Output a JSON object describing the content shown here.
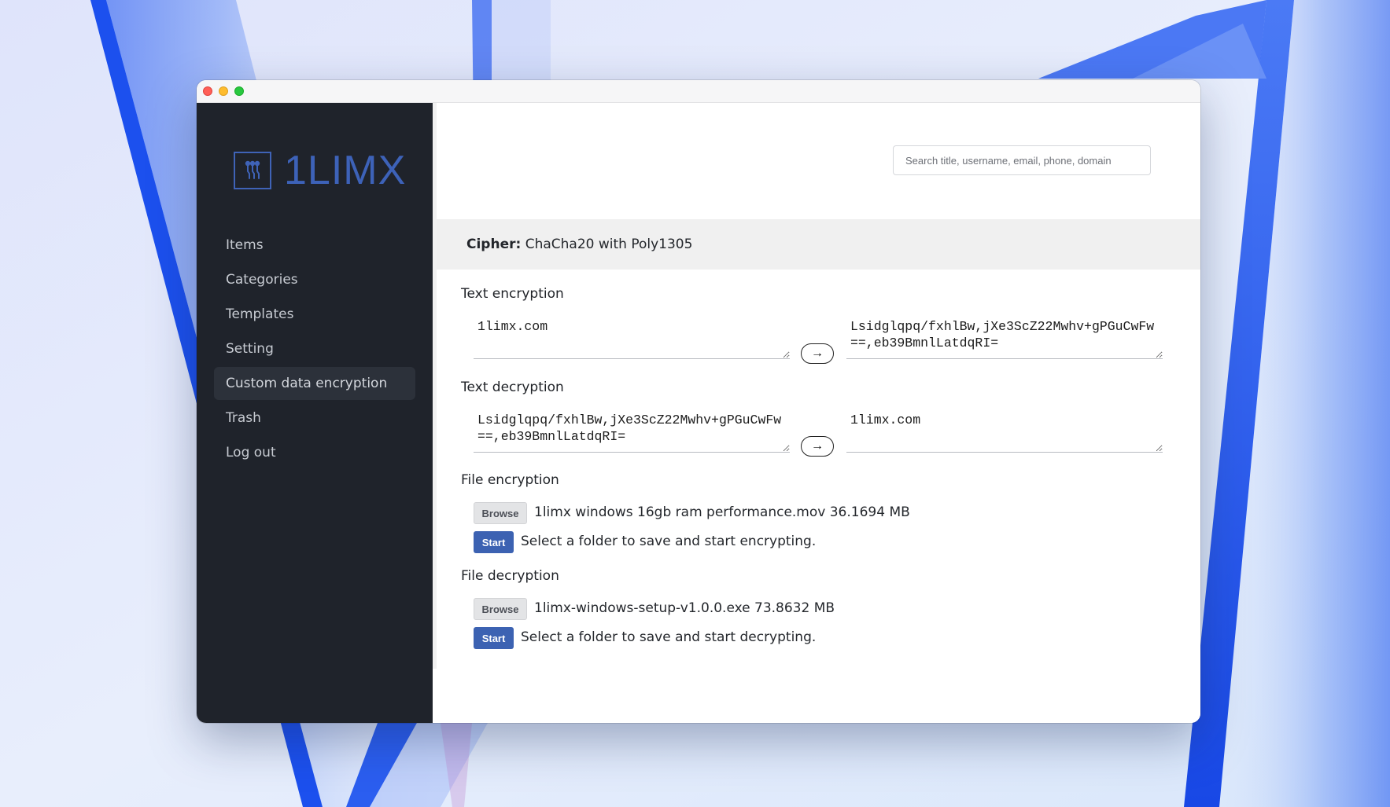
{
  "app": {
    "logo_text": "1LIMX"
  },
  "sidebar": {
    "items": [
      {
        "label": "Items"
      },
      {
        "label": "Categories"
      },
      {
        "label": "Templates"
      },
      {
        "label": "Setting"
      },
      {
        "label": "Custom data encryption",
        "active": true
      },
      {
        "label": "Trash"
      },
      {
        "label": "Log out"
      }
    ]
  },
  "header": {
    "search_placeholder": "Search title, username, email, phone, domain"
  },
  "cipher": {
    "label": "Cipher:",
    "value": "ChaCha20 with Poly1305"
  },
  "text_encryption": {
    "title": "Text encryption",
    "input": "1limx.com",
    "output": "Lsidglqpq/fxhlBw,jXe3ScZ22Mwhv+gPGuCwFw==,eb39BmnlLatdqRI=",
    "arrow": "→"
  },
  "text_decryption": {
    "title": "Text decryption",
    "input": "Lsidglqpq/fxhlBw,jXe3ScZ22Mwhv+gPGuCwFw==,eb39BmnlLatdqRI=",
    "output": "1limx.com",
    "arrow": "→"
  },
  "file_encryption": {
    "title": "File encryption",
    "browse_label": "Browse",
    "file_info": "1limx windows 16gb ram performance.mov 36.1694 MB",
    "start_label": "Start",
    "hint": "Select a folder to save and start encrypting."
  },
  "file_decryption": {
    "title": "File decryption",
    "browse_label": "Browse",
    "file_info": "1limx-windows-setup-v1.0.0.exe 73.8632 MB",
    "start_label": "Start",
    "hint": "Select a folder to save and start decrypting."
  },
  "colors": {
    "sidebar_bg": "#1f232b",
    "accent": "#3c62b2",
    "cipher_bar_bg": "#f0f0f0"
  }
}
